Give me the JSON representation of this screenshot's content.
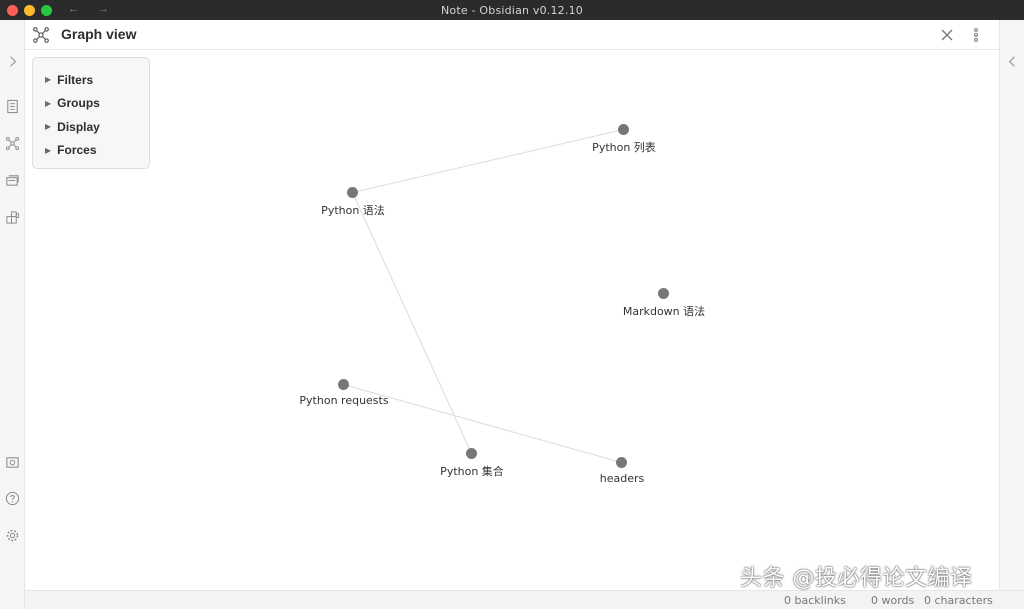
{
  "window": {
    "title": "Note - Obsidian v0.12.10",
    "back_arrow": "←",
    "forward_arrow": "→"
  },
  "ribbon_left": {
    "icons": [
      "chevron-right-icon",
      "file-explorer-icon",
      "graph-icon",
      "cards-icon",
      "plugins-icon",
      "vault-icon",
      "help-icon",
      "settings-icon"
    ]
  },
  "ribbon_right": {
    "icons": [
      "chevron-left-icon"
    ]
  },
  "view": {
    "title": "Graph view",
    "icon": "graph-icon",
    "actions": [
      "close-icon",
      "more-options-icon"
    ]
  },
  "controls": {
    "sections": [
      {
        "label": "Filters"
      },
      {
        "label": "Groups"
      },
      {
        "label": "Display"
      },
      {
        "label": "Forces"
      }
    ]
  },
  "graph": {
    "nodes": [
      {
        "label": "Python 列表"
      },
      {
        "label": "Python 语法"
      },
      {
        "label": "Markdown 语法"
      },
      {
        "label": "Python requests"
      },
      {
        "label": "Python 集合"
      },
      {
        "label": "headers"
      }
    ],
    "edges": [
      {
        "from": "Python 语法",
        "to": "Python 列表"
      },
      {
        "from": "Python 语法",
        "to": "Python 集合"
      },
      {
        "from": "Python requests",
        "to": "headers"
      }
    ],
    "node_color": "#777777",
    "edge_color": "#dcdcdc"
  },
  "status": {
    "backlinks": "0 backlinks",
    "words": "0 words",
    "characters": "0 characters"
  },
  "watermark": "头条 @投必得论文编译"
}
